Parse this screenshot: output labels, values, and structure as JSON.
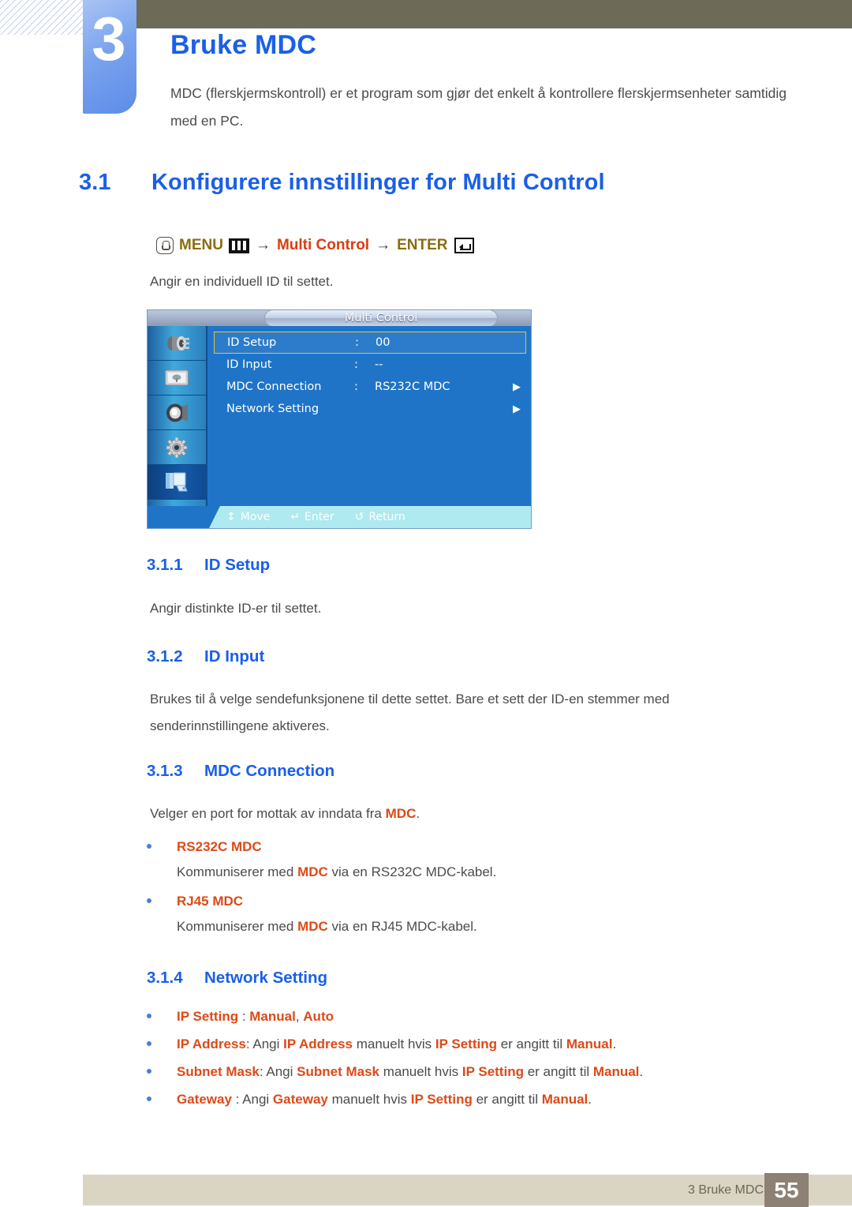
{
  "chapter": {
    "number": "3",
    "title": "Bruke MDC",
    "intro": "MDC (flerskjermskontroll) er et program som gjør det enkelt å kontrollere flerskjermsenheter samtidig med en PC."
  },
  "section": {
    "number": "3.1",
    "title": "Konfigurere innstillinger for Multi Control",
    "menu_path": {
      "menu_label": "MENU",
      "arrow1": "→",
      "target": "Multi Control",
      "arrow2": "→",
      "enter_label": "ENTER",
      "menu_key_icon": "menu-hand-key-icon",
      "menu_bars_icon": "menu-bars-icon",
      "enter_key_icon": "enter-key-icon"
    },
    "description": "Angir en individuell ID til settet."
  },
  "osd": {
    "title": "Multi Control",
    "side_icons": [
      {
        "name": "input-source-icon",
        "selected": false
      },
      {
        "name": "picture-display-icon",
        "selected": false
      },
      {
        "name": "sound-speaker-icon",
        "selected": false
      },
      {
        "name": "setup-gear-icon",
        "selected": false
      },
      {
        "name": "multi-control-icon",
        "selected": true
      }
    ],
    "rows": [
      {
        "label": "ID Setup",
        "colon": ":",
        "value": "00",
        "arrow": "",
        "highlighted": true
      },
      {
        "label": "ID Input",
        "colon": ":",
        "value": "--",
        "arrow": "",
        "highlighted": false
      },
      {
        "label": "MDC Connection",
        "colon": ":",
        "value": "RS232C MDC",
        "arrow": "▶",
        "highlighted": false
      },
      {
        "label": "Network Setting",
        "colon": "",
        "value": "",
        "arrow": "▶",
        "highlighted": false
      }
    ],
    "footer_keys": [
      {
        "glyph": "↕",
        "label": "Move",
        "icon": "move-updown-icon"
      },
      {
        "glyph": "↵",
        "label": "Enter",
        "icon": "enter-icon"
      },
      {
        "glyph": "↺",
        "label": "Return",
        "icon": "return-icon"
      }
    ]
  },
  "subsections": {
    "id_setup": {
      "number": "3.1.1",
      "title": "ID Setup",
      "body": "Angir distinkte ID-er til settet."
    },
    "id_input": {
      "number": "3.1.2",
      "title": "ID Input",
      "body": "Brukes til å velge sendefunksjonene til dette settet. Bare et sett der ID-en stemmer med senderinnstillingene aktiveres."
    },
    "mdc_connection": {
      "number": "3.1.3",
      "title": "MDC Connection",
      "lead_pre": "Velger en port for mottak av inndata fra ",
      "lead_em": "MDC",
      "lead_post": ".",
      "items": [
        {
          "title": "RS232C MDC",
          "desc_pre": "Kommuniserer med ",
          "desc_em": "MDC",
          "desc_post": " via en RS232C MDC-kabel."
        },
        {
          "title": "RJ45 MDC",
          "desc_pre": "Kommuniserer med ",
          "desc_em": "MDC",
          "desc_post": " via en RJ45 MDC-kabel."
        }
      ]
    },
    "network_setting": {
      "number": "3.1.4",
      "title": "Network Setting",
      "bullets": [
        {
          "html_parts": [
            {
              "t": "IP Setting",
              "em": true
            },
            {
              "t": " : ",
              "em": false
            },
            {
              "t": "Manual",
              "em": true
            },
            {
              "t": ", ",
              "em": false
            },
            {
              "t": "Auto",
              "em": true
            }
          ]
        },
        {
          "html_parts": [
            {
              "t": "IP Address",
              "em": true
            },
            {
              "t": ": Angi ",
              "em": false
            },
            {
              "t": "IP Address",
              "em": true
            },
            {
              "t": " manuelt hvis ",
              "em": false
            },
            {
              "t": "IP Setting",
              "em": true
            },
            {
              "t": " er angitt til ",
              "em": false
            },
            {
              "t": "Manual",
              "em": true
            },
            {
              "t": ".",
              "em": false
            }
          ]
        },
        {
          "html_parts": [
            {
              "t": "Subnet Mask",
              "em": true
            },
            {
              "t": ": Angi ",
              "em": false
            },
            {
              "t": "Subnet Mask",
              "em": true
            },
            {
              "t": " manuelt hvis ",
              "em": false
            },
            {
              "t": "IP Setting",
              "em": true
            },
            {
              "t": " er angitt til ",
              "em": false
            },
            {
              "t": "Manual",
              "em": true
            },
            {
              "t": ".",
              "em": false
            }
          ]
        },
        {
          "html_parts": [
            {
              "t": "Gateway",
              "em": true
            },
            {
              "t": " : Angi ",
              "em": false
            },
            {
              "t": "Gateway",
              "em": true
            },
            {
              "t": " manuelt hvis ",
              "em": false
            },
            {
              "t": "IP Setting",
              "em": true
            },
            {
              "t": " er angitt til ",
              "em": false
            },
            {
              "t": "Manual",
              "em": true
            },
            {
              "t": ".",
              "em": false
            }
          ]
        }
      ]
    }
  },
  "footer": {
    "label": "3 Bruke MDC",
    "page": "55"
  },
  "colors": {
    "heading_blue": "#1a5fe8",
    "accent_orange": "#dc4a18",
    "gold": "#8a6d12",
    "olive_bar": "#6d6a57",
    "footer_beige": "#d9d5c2",
    "page_box": "#8d8074",
    "osd_blue": "#1f74c8",
    "osd_highlight": "#e8c33a",
    "bullet_blue": "#4a7fd4"
  }
}
